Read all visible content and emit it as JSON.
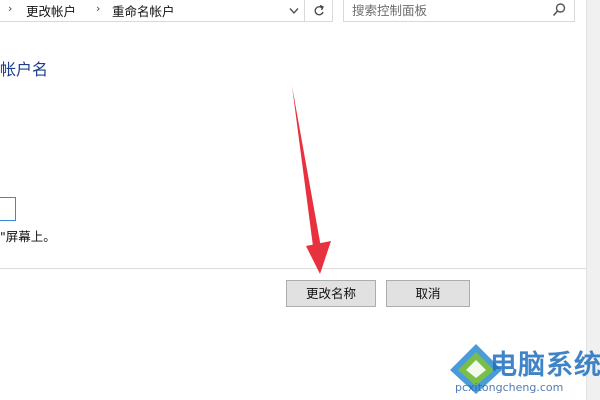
{
  "address_bar": {
    "breadcrumbs": [
      "更改帐户",
      "重命名帐户"
    ],
    "separator": "›",
    "dropdown_icon": "chevron-down-icon",
    "refresh_icon": "refresh-icon"
  },
  "search": {
    "placeholder": "搜索控制面板",
    "icon": "search-icon"
  },
  "main": {
    "title": "帐户名",
    "hint": "\"屏幕上。",
    "name_value": ""
  },
  "buttons": {
    "rename_label": "更改名称",
    "cancel_label": "取消"
  },
  "annotation": {
    "arrow_color": "#e8313f"
  },
  "watermark": {
    "title": "电脑系统城",
    "url": "pcxitongcheng.com"
  }
}
